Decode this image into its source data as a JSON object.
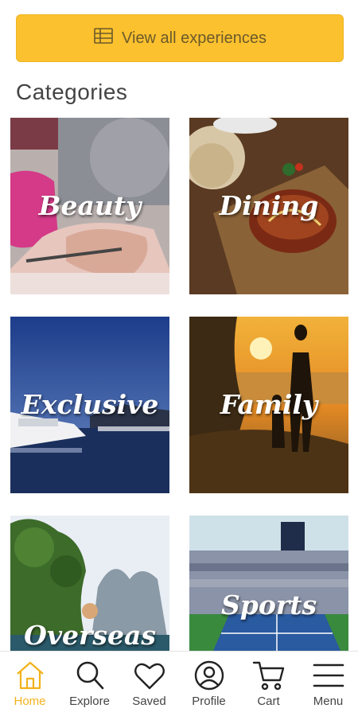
{
  "cta": {
    "label": "View all experiences",
    "icon": "table-icon",
    "color": "#fcc12e"
  },
  "categories_heading": "Categories",
  "categories": [
    {
      "label": "Beauty",
      "image": "nail-manicure-photo"
    },
    {
      "label": "Dining",
      "image": "steak-board-photo"
    },
    {
      "label": "Exclusive",
      "image": "yacht-marina-photo"
    },
    {
      "label": "Family",
      "image": "father-child-sunset-photo"
    },
    {
      "label": "Overseas\nbreaks",
      "image": "tropical-cliffs-photo"
    },
    {
      "label": "Sports",
      "image": "tennis-stadium-photo"
    }
  ],
  "nav": [
    {
      "label": "Home",
      "icon": "home-icon",
      "active": true,
      "color": "#f2b21c"
    },
    {
      "label": "Explore",
      "icon": "search-icon"
    },
    {
      "label": "Saved",
      "icon": "heart-icon"
    },
    {
      "label": "Profile",
      "icon": "user-icon"
    },
    {
      "label": "Cart",
      "icon": "cart-icon"
    },
    {
      "label": "Menu",
      "icon": "hamburger-icon"
    }
  ]
}
